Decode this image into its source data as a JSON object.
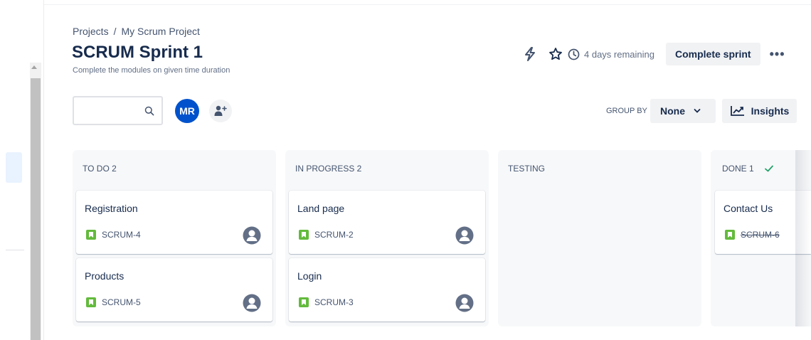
{
  "breadcrumb": {
    "root": "Projects",
    "separator": "/",
    "project": "My Scrum Project"
  },
  "header": {
    "title": "SCRUM Sprint 1",
    "subtitle": "Complete the modules on given time duration",
    "remaining": "4 days remaining",
    "complete_label": "Complete sprint",
    "more_label": "•••"
  },
  "toolbar": {
    "search_placeholder": "",
    "avatar_initials": "MR",
    "group_by_label": "GROUP BY",
    "group_by_value": "None",
    "insights_label": "Insights"
  },
  "columns": [
    {
      "title": "TO DO 2",
      "cards": [
        {
          "title": "Registration",
          "key": "SCRUM-4"
        },
        {
          "title": "Products",
          "key": "SCRUM-5"
        }
      ]
    },
    {
      "title": "IN PROGRESS 2",
      "cards": [
        {
          "title": "Land page",
          "key": "SCRUM-2"
        },
        {
          "title": "Login",
          "key": "SCRUM-3"
        }
      ]
    },
    {
      "title": "TESTING",
      "cards": []
    },
    {
      "title": "DONE 1",
      "cards": [
        {
          "title": "Contact Us",
          "key": "SCRUM-6"
        }
      ]
    }
  ],
  "colors": {
    "accent": "#0052cc",
    "story": "#63ba3c",
    "done_check": "#22a06b",
    "column_bg": "#f7f8f9"
  }
}
